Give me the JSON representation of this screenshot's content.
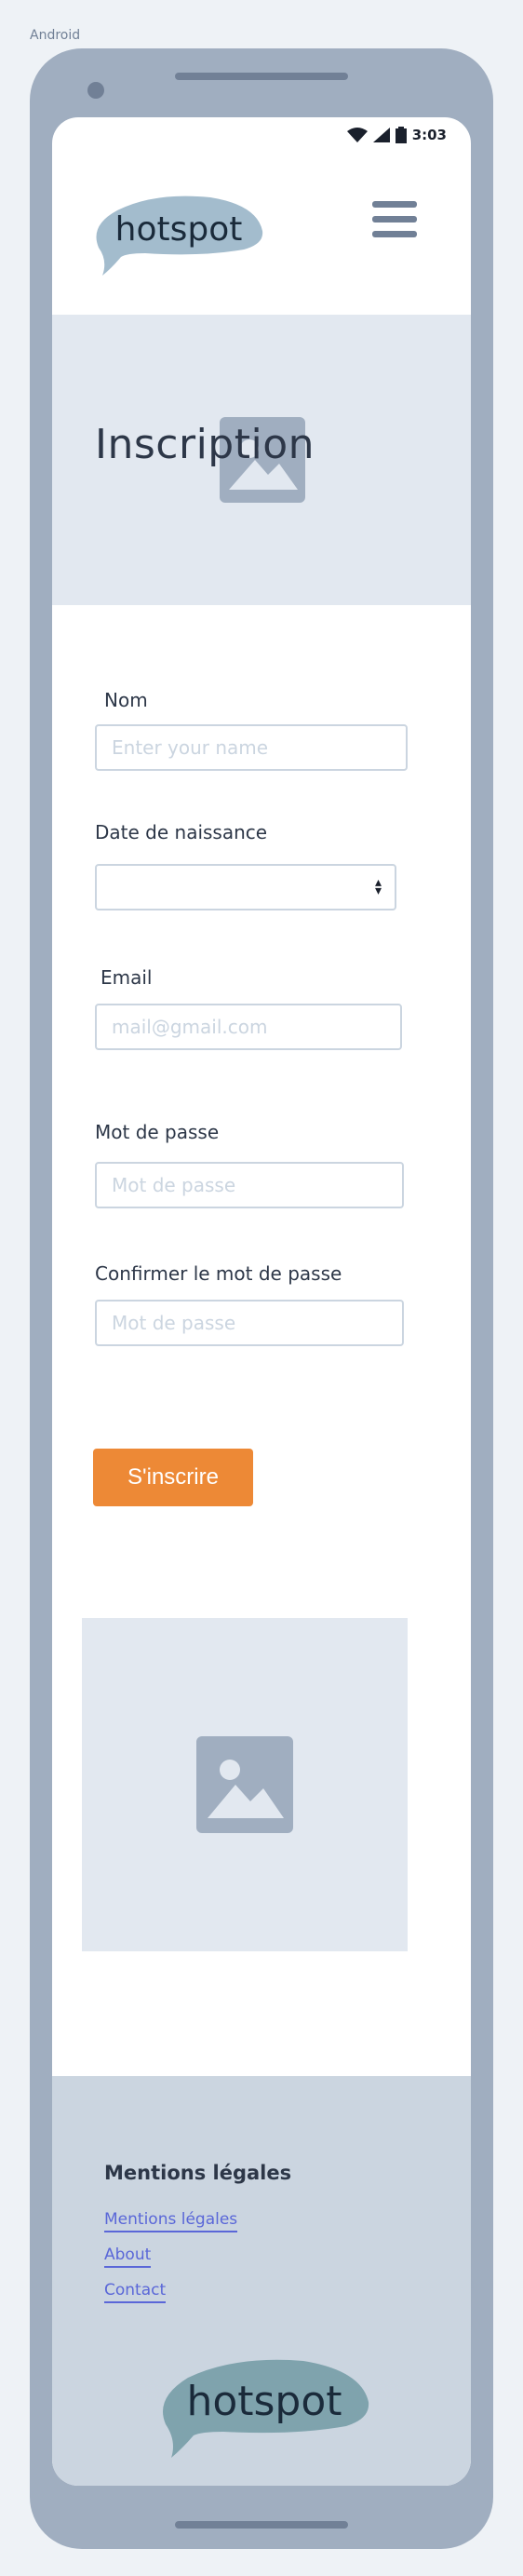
{
  "frame": {
    "label": "Android"
  },
  "status_bar": {
    "time": "3:03",
    "icons": [
      "wifi-icon",
      "signal-icon",
      "battery-icon"
    ]
  },
  "header": {
    "logo_text": "hotspot",
    "menu_icon": "hamburger-menu-icon"
  },
  "hero": {
    "title": "Inscription",
    "image_icon": "image-placeholder-icon"
  },
  "form": {
    "name": {
      "label": "Nom",
      "placeholder": "Enter your name"
    },
    "birthdate": {
      "label": "Date de naissance",
      "value": ""
    },
    "email": {
      "label": "Email",
      "placeholder": "mail@gmail.com"
    },
    "password": {
      "label": "Mot de passe",
      "placeholder": "Mot de passe"
    },
    "confirm_password": {
      "label": "Confirmer le mot de passe",
      "placeholder": "Mot de passe"
    },
    "submit_label": "S'inscrire"
  },
  "content": {
    "image_icon": "image-placeholder-icon"
  },
  "footer": {
    "title": "Mentions légales",
    "links": [
      "Mentions légales",
      "About",
      "Contact"
    ],
    "logo_text": "hotspot"
  },
  "colors": {
    "accent": "#ed8936",
    "link": "#5a67d8",
    "phone_frame": "#a0aec0",
    "hero_bg": "#e2e8f0",
    "footer_bg": "#cbd5e0"
  }
}
